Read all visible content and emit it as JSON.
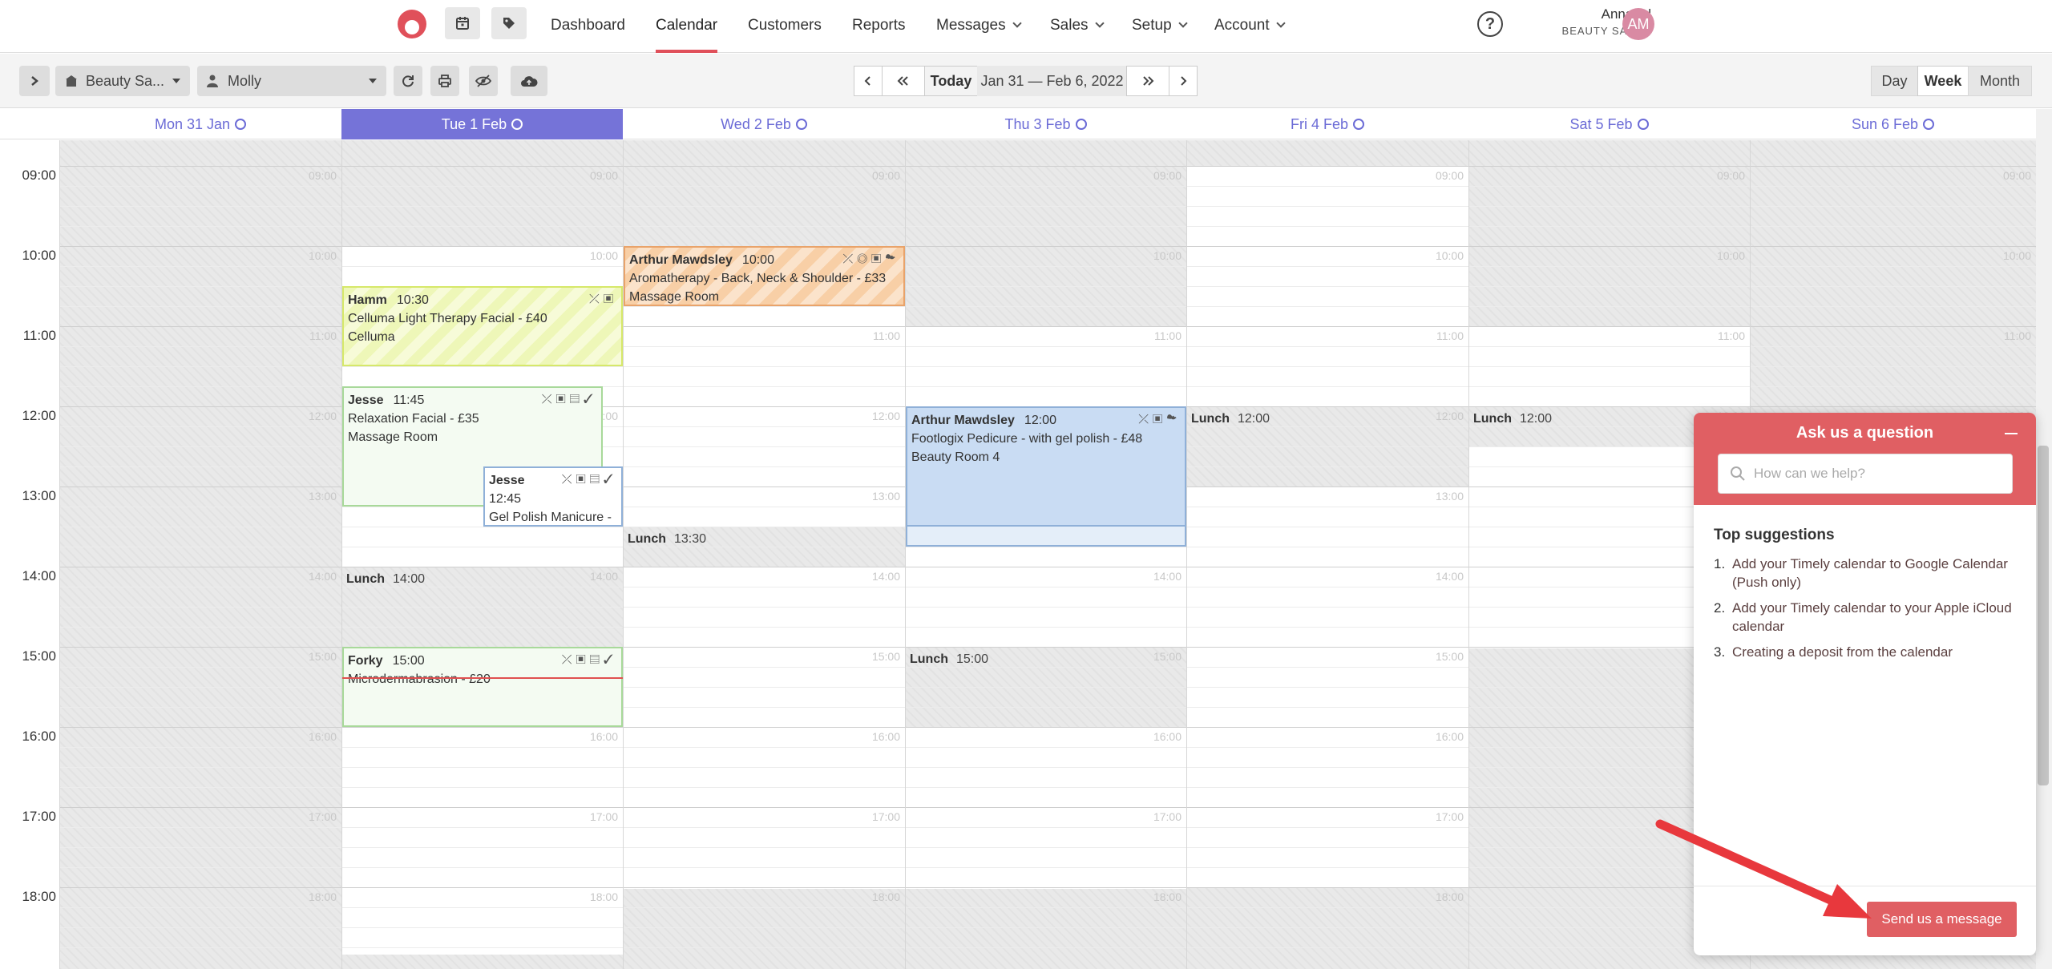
{
  "nav": {
    "links": [
      "Dashboard",
      "Calendar",
      "Customers",
      "Reports",
      "Messages",
      "Sales",
      "Setup",
      "Account"
    ],
    "user_name": "Annabel",
    "user_salon": "BEAUTY SALON",
    "avatar": "AM",
    "help": "?"
  },
  "toolbar": {
    "location": "Beauty Sa...",
    "staff": "Molly",
    "today": "Today",
    "range": "Jan 31 — Feb 6, 2022",
    "views": [
      "Day",
      "Week",
      "Month"
    ]
  },
  "days": [
    "Mon 31 Jan",
    "Tue 1 Feb",
    "Wed 2 Feb",
    "Thu 3 Feb",
    "Fri 4 Feb",
    "Sat 5 Feb",
    "Sun 6 Feb"
  ],
  "hours": [
    "09:00",
    "10:00",
    "11:00",
    "12:00",
    "13:00",
    "14:00",
    "15:00",
    "16:00",
    "17:00",
    "18:00"
  ],
  "appointments": [
    {
      "customer": "Hamm",
      "time": "10:30",
      "service": "Celluma Light Therapy Facial - £40",
      "room": "Celluma"
    },
    {
      "customer": "Arthur Mawdsley",
      "time": "10:00",
      "service": "Aromatherapy - Back, Neck & Shoulder - £33",
      "room": "Massage Room"
    },
    {
      "customer": "Jesse",
      "time": "11:45",
      "service": "Relaxation Facial - £35",
      "room": "Massage Room"
    },
    {
      "customer": "Jesse",
      "time": "12:45",
      "service": "Gel Polish Manicure -",
      "room": ""
    },
    {
      "customer": "Arthur Mawdsley",
      "time": "12:00",
      "service": "Footlogix Pedicure - with gel polish - £48",
      "room": "Beauty Room 4"
    },
    {
      "customer": "Forky",
      "time": "15:00",
      "service": "Microdermabrasion - £20",
      "room": ""
    }
  ],
  "lunches": [
    {
      "label": "Lunch",
      "time": "13:30"
    },
    {
      "label": "Lunch",
      "time": "14:00"
    },
    {
      "label": "Lunch",
      "time": "15:00"
    },
    {
      "label": "Lunch",
      "time": "12:00"
    },
    {
      "label": "Lunch",
      "time": "12:00"
    }
  ],
  "widget": {
    "title": "Ask us a question",
    "search_placeholder": "How can we help?",
    "top_heading": "Top suggestions",
    "suggestions": [
      "Add your Timely calendar to Google Calendar (Push only)",
      "Add your Timely calendar to your Apple iCloud calendar",
      "Creating a deposit from the calendar"
    ],
    "send_label": "Send us a message"
  },
  "colors": {
    "brand": "#e05f63",
    "today": "#7573d8",
    "arrow": "#e8383d"
  }
}
